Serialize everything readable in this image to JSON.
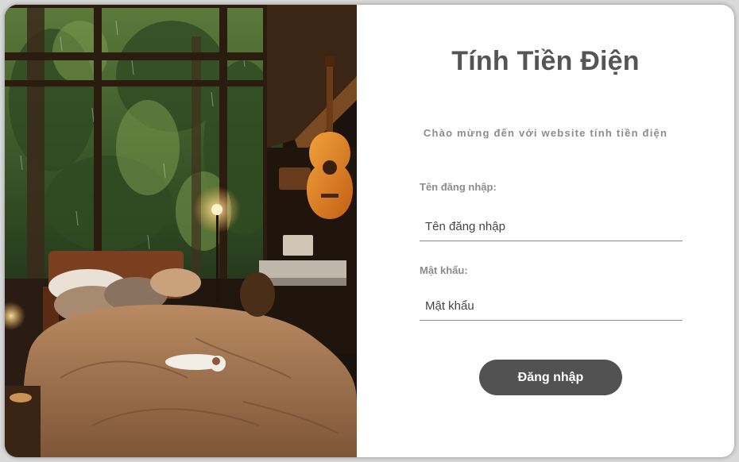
{
  "scene": {
    "description_icon": "cozy-bedroom-illustration"
  },
  "form": {
    "title": "Tính Tiền Điện",
    "subtitle": "Chào mừng đến với website tính tiền điện",
    "username_label": "Tên đăng nhập:",
    "username_placeholder": "Tên đăng nhập",
    "username_value": "",
    "password_label": "Mật khẩu:",
    "password_placeholder": "Mật khẩu",
    "password_value": "",
    "login_button": "Đăng nhập"
  },
  "colors": {
    "button_bg": "#525252",
    "title": "#555555",
    "label": "#8c8c8c",
    "underline": "#8a8a8a"
  }
}
